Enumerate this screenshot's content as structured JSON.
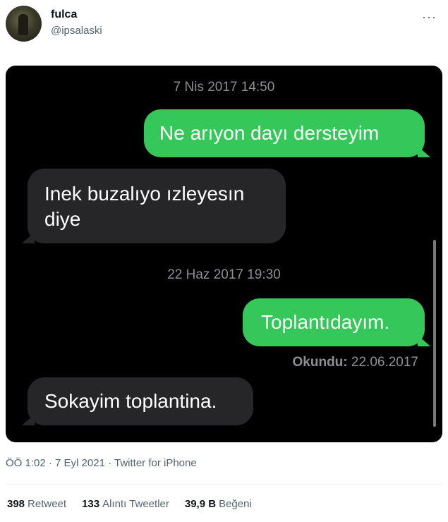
{
  "tweet": {
    "author": {
      "name": "fulca",
      "handle": "@ipsalaski"
    },
    "more_label": "···",
    "media": {
      "timestamp_1": "7 Nis 2017 14:50",
      "timestamp_2": "22 Haz 2017 19:30",
      "messages": [
        {
          "type": "sent",
          "text": "Ne arıyon dayı dersteyim"
        },
        {
          "type": "received",
          "text": "Inek buzalıyo ızleyesın diye"
        },
        {
          "type": "sent",
          "text": "Toplantıdayım."
        },
        {
          "type": "received",
          "text": "Sokayim toplantina."
        }
      ],
      "read_label": "Okundu:",
      "read_date": "22.06.2017",
      "colors": {
        "sent_bubble": "#35c759",
        "received_bubble": "#262628",
        "background": "#000000"
      }
    },
    "meta": {
      "time_date": "ÖÖ 1:02 · 7 Eyl 2021 · ",
      "source": "Twitter for iPhone"
    },
    "stats": {
      "retweets": {
        "count": "398",
        "label": "Retweet"
      },
      "quotes": {
        "count": "133",
        "label": "Alıntı Tweetler"
      },
      "likes": {
        "count": "39,9 B",
        "label": "Beğeni"
      }
    }
  }
}
